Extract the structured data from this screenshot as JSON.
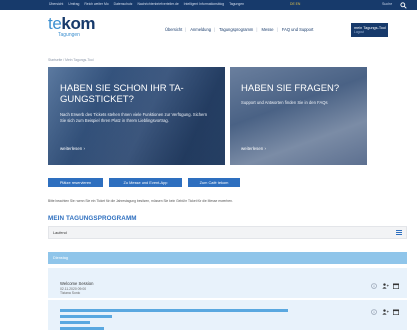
{
  "topbar": {
    "links": [
      "Übersicht",
      "Umfrag",
      "Reich weiter Mo",
      "Datenschutz",
      "Nachrichtenbriefverteiler.de",
      "Intelligent Informationsblog",
      "Tagungen"
    ],
    "languages": "DE  EN",
    "search_label": "Suche"
  },
  "header": {
    "logo_word_a": "te",
    "logo_word_b": "kom",
    "logo_sub": "Tagungen",
    "nav": [
      "Übersicht",
      "Anmeldung",
      "Tagungsprogramm",
      "Messe",
      "FAQ und Support"
    ],
    "my_button_line1": "mein Tagungs-Tool",
    "my_button_line2": "Logout"
  },
  "breadcrumb": "Startseite / Mein Tagungs-Tool",
  "cards": [
    {
      "title": "HABEN SIE SCHON IHR TA-GUNGSTICKET?",
      "description": "Nach Erwerb des Tickets stehen Ihnen viele Funktionen zur Verfügung. Sichern Sie sich zum Beispiel Ihren Platz in Ihrem Lieblingsvortrag.",
      "more": "weiterlesen"
    },
    {
      "title": "HABEN SIE FRAGEN?",
      "description": "Support und Antworten finden Sie in den FAQs",
      "more": "weiterlesen"
    }
  ],
  "actions": [
    "Plätze reservieren",
    "Zu Messe und Event-App",
    "Zum Café tekom"
  ],
  "note": "Bitte beachten Sie: wenn Sie ein Ticket für die Jahrestagung besitzen, müssen Sie kein Gebühr Ticket für die Messe erwerben.",
  "section_title": "MEIN TAGUNGSPROGRAMM",
  "filter_label": "Laufend",
  "date_label": "Dienstag",
  "session": {
    "title": "Welcome Session",
    "date": "02.11.2020 09:00",
    "speaker": "Tiziana Sonic"
  },
  "colors": {
    "navy": "#173a6b",
    "primary_blue": "#2e6fbf",
    "light_blue": "#8fc5ea"
  }
}
